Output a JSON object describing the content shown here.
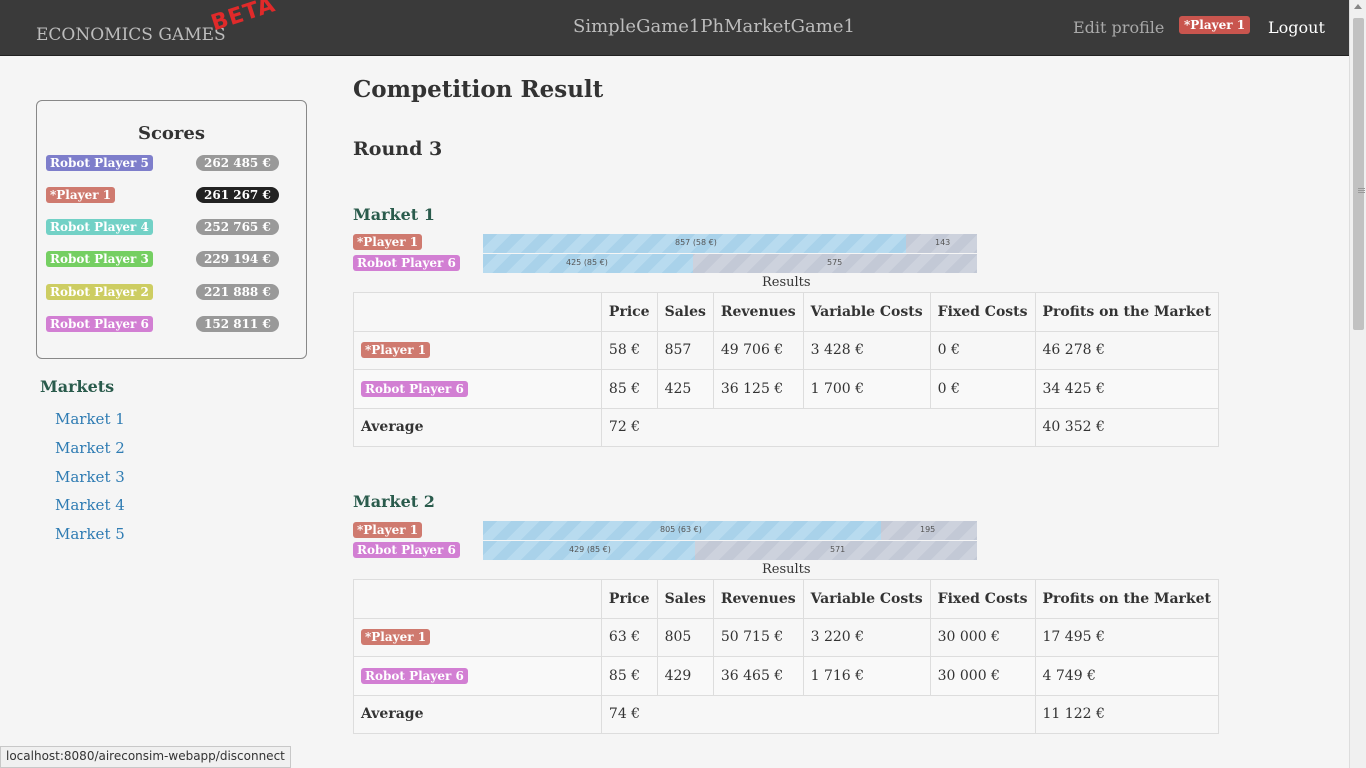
{
  "navbar": {
    "brand": "ECONOMICS GAMES",
    "beta": "BETA",
    "game_title": "SimpleGame1PhMarketGame1",
    "edit_profile": "Edit profile",
    "player_badge": "*Player 1",
    "logout": "Logout"
  },
  "colors": {
    "navbar_bg": "#3a3a3a",
    "robot5": "#7e7ecb",
    "player1": "#cf7a6f",
    "robot4": "#72d1c6",
    "robot3": "#75cf62",
    "robot2": "#cdcd62",
    "robot6": "#d27fd3",
    "link": "#2f7cb3",
    "heading_green": "#2a5b4c"
  },
  "scores": {
    "title": "Scores",
    "rows": [
      {
        "name": "Robot Player 5",
        "score": "262 485 €"
      },
      {
        "name": "*Player 1",
        "score": "261 267 €"
      },
      {
        "name": "Robot Player 4",
        "score": "252 765 €"
      },
      {
        "name": "Robot Player 3",
        "score": "229 194 €"
      },
      {
        "name": "Robot Player 2",
        "score": "221 888 €"
      },
      {
        "name": "Robot Player 6",
        "score": "152 811 €"
      }
    ]
  },
  "markets": {
    "title": "Markets",
    "links": [
      "Market 1",
      "Market 2",
      "Market 3",
      "Market 4",
      "Market 5"
    ]
  },
  "main": {
    "title": "Competition Result",
    "round": "Round 3",
    "caption": "Results",
    "headers": [
      "",
      "Price",
      "Sales",
      "Revenues",
      "Variable Costs",
      "Fixed Costs",
      "Profits on the Market"
    ],
    "average_label": "Average"
  },
  "market_results": [
    {
      "title": "Market 1",
      "bars": [
        {
          "player": "*Player 1",
          "fill_text": "857 (58 €)",
          "rest_text": "143",
          "fill_fraction": 0.857
        },
        {
          "player": "Robot Player 6",
          "fill_text": "425 (85 €)",
          "rest_text": "575",
          "fill_fraction": 0.425
        }
      ],
      "rows": [
        {
          "player": "*Player 1",
          "price": "58 €",
          "sales": "857",
          "revenues": "49 706 €",
          "variable_costs": "3 428 €",
          "fixed_costs": "0 €",
          "profits": "46 278 €"
        },
        {
          "player": "Robot Player 6",
          "price": "85 €",
          "sales": "425",
          "revenues": "36 125 €",
          "variable_costs": "1 700 €",
          "fixed_costs": "0 €",
          "profits": "34 425 €"
        }
      ],
      "average": {
        "price": "72 €",
        "profits": "40 352 €"
      }
    },
    {
      "title": "Market 2",
      "bars": [
        {
          "player": "*Player 1",
          "fill_text": "805 (63 €)",
          "rest_text": "195",
          "fill_fraction": 0.805
        },
        {
          "player": "Robot Player 6",
          "fill_text": "429 (85 €)",
          "rest_text": "571",
          "fill_fraction": 0.429
        }
      ],
      "rows": [
        {
          "player": "*Player 1",
          "price": "63 €",
          "sales": "805",
          "revenues": "50 715 €",
          "variable_costs": "3 220 €",
          "fixed_costs": "30 000 €",
          "profits": "17 495 €"
        },
        {
          "player": "Robot Player 6",
          "price": "85 €",
          "sales": "429",
          "revenues": "36 465 €",
          "variable_costs": "1 716 €",
          "fixed_costs": "30 000 €",
          "profits": "4 749 €"
        }
      ],
      "average": {
        "price": "74 €",
        "profits": "11 122 €"
      }
    }
  ],
  "status_bar": {
    "url": "localhost:8080/aireconsim-webapp/disconnect"
  }
}
